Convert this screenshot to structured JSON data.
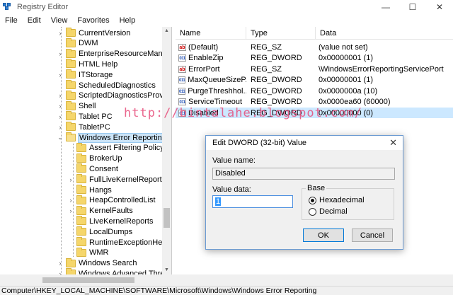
{
  "window": {
    "title": "Registry Editor",
    "controls": {
      "minimize": "—",
      "maximize": "☐",
      "close": "✕"
    }
  },
  "menu": [
    "File",
    "Edit",
    "View",
    "Favorites",
    "Help"
  ],
  "tree": [
    {
      "label": "CurrentVersion",
      "expander": "›"
    },
    {
      "label": "DWM",
      "expander": ""
    },
    {
      "label": "EnterpriseResourceManage",
      "expander": "›"
    },
    {
      "label": "HTML Help",
      "expander": ""
    },
    {
      "label": "ITStorage",
      "expander": "›"
    },
    {
      "label": "ScheduledDiagnostics",
      "expander": ""
    },
    {
      "label": "ScriptedDiagnosticsProvide",
      "expander": "›"
    },
    {
      "label": "Shell",
      "expander": "›"
    },
    {
      "label": "Tablet PC",
      "expander": "›"
    },
    {
      "label": "TabletPC",
      "expander": "›"
    },
    {
      "label": "Windows Error Reporting",
      "expander": "⌄"
    },
    {
      "label": "Assert Filtering Policy",
      "expander": ""
    },
    {
      "label": "BrokerUp",
      "expander": ""
    },
    {
      "label": "Consent",
      "expander": ""
    },
    {
      "label": "FullLiveKernelReports",
      "expander": "›"
    },
    {
      "label": "Hangs",
      "expander": ""
    },
    {
      "label": "HeapControlledList",
      "expander": "›"
    },
    {
      "label": "KernelFaults",
      "expander": "›"
    },
    {
      "label": "LiveKernelReports",
      "expander": ""
    },
    {
      "label": "LocalDumps",
      "expander": ""
    },
    {
      "label": "RuntimeExceptionHelp",
      "expander": ""
    },
    {
      "label": "WMR",
      "expander": ""
    },
    {
      "label": "Windows Search",
      "expander": "›"
    },
    {
      "label": "Windows Advanced Threat Pr",
      "expander": "›"
    }
  ],
  "list": {
    "columns": [
      "Name",
      "Type",
      "Data"
    ],
    "rows": [
      {
        "icon": "ab",
        "name": "(Default)",
        "type": "REG_SZ",
        "data": "(value not set)"
      },
      {
        "icon": "011",
        "name": "EnableZip",
        "type": "REG_DWORD",
        "data": "0x00000001 (1)"
      },
      {
        "icon": "ab",
        "name": "ErrorPort",
        "type": "REG_SZ",
        "data": "\\WindowsErrorReportingServicePort"
      },
      {
        "icon": "011",
        "name": "MaxQueueSizeP...",
        "type": "REG_DWORD",
        "data": "0x00000001 (1)"
      },
      {
        "icon": "011",
        "name": "PurgeThreshhol...",
        "type": "REG_DWORD",
        "data": "0x0000000a (10)"
      },
      {
        "icon": "011",
        "name": "ServiceTimeout",
        "type": "REG_DWORD",
        "data": "0x0000ea60 (60000)"
      },
      {
        "icon": "011",
        "name": "Disabled",
        "type": "REG_DWORD",
        "data": "0x00000000 (0)"
      }
    ]
  },
  "watermark": "http://bintalahe.blogspot.com/",
  "status_path": "Computer\\HKEY_LOCAL_MACHINE\\SOFTWARE\\Microsoft\\Windows\\Windows Error Reporting",
  "dialog": {
    "title": "Edit DWORD (32-bit) Value",
    "close": "✕",
    "value_name_label": "Value name:",
    "value_name": "Disabled",
    "value_data_label": "Value data:",
    "value_data": "1",
    "base_label": "Base",
    "hex_label": "Hexadecimal",
    "dec_label": "Decimal",
    "base_selected": "Hexadecimal",
    "ok_label": "OK",
    "cancel_label": "Cancel"
  },
  "colors": {
    "selection": "#cce8ff",
    "accent": "#0078d7",
    "watermark": "#e74c7a"
  }
}
